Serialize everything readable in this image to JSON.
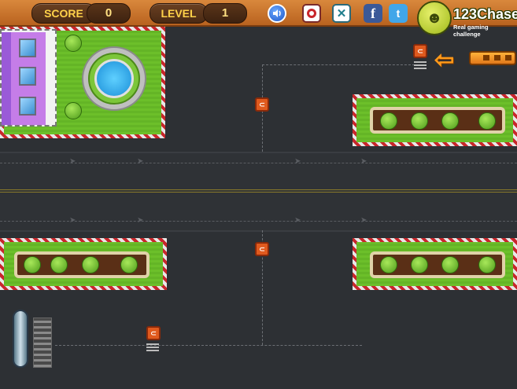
{
  "hud": {
    "score_label": "SCORE",
    "score_value": "0",
    "level_label": "LEVEL",
    "level_value": "1"
  },
  "logo": {
    "title": "123Chase",
    "subtitle": "Real gaming challenge"
  },
  "icons": {
    "sound": "speaker-icon",
    "power": "power-icon",
    "tools": "tools-icon",
    "facebook": "facebook-icon",
    "twitter": "twitter-icon"
  },
  "glyphs": {
    "facebook": "f",
    "twitter": "t",
    "tools": "✕",
    "sound": "🔊",
    "left_arrow": "⇦"
  },
  "colors": {
    "hud": "#c8722a",
    "road": "#2f3236",
    "grass": "#6cbf2a",
    "car": "#e05a1e",
    "border_red": "#c8262b"
  }
}
